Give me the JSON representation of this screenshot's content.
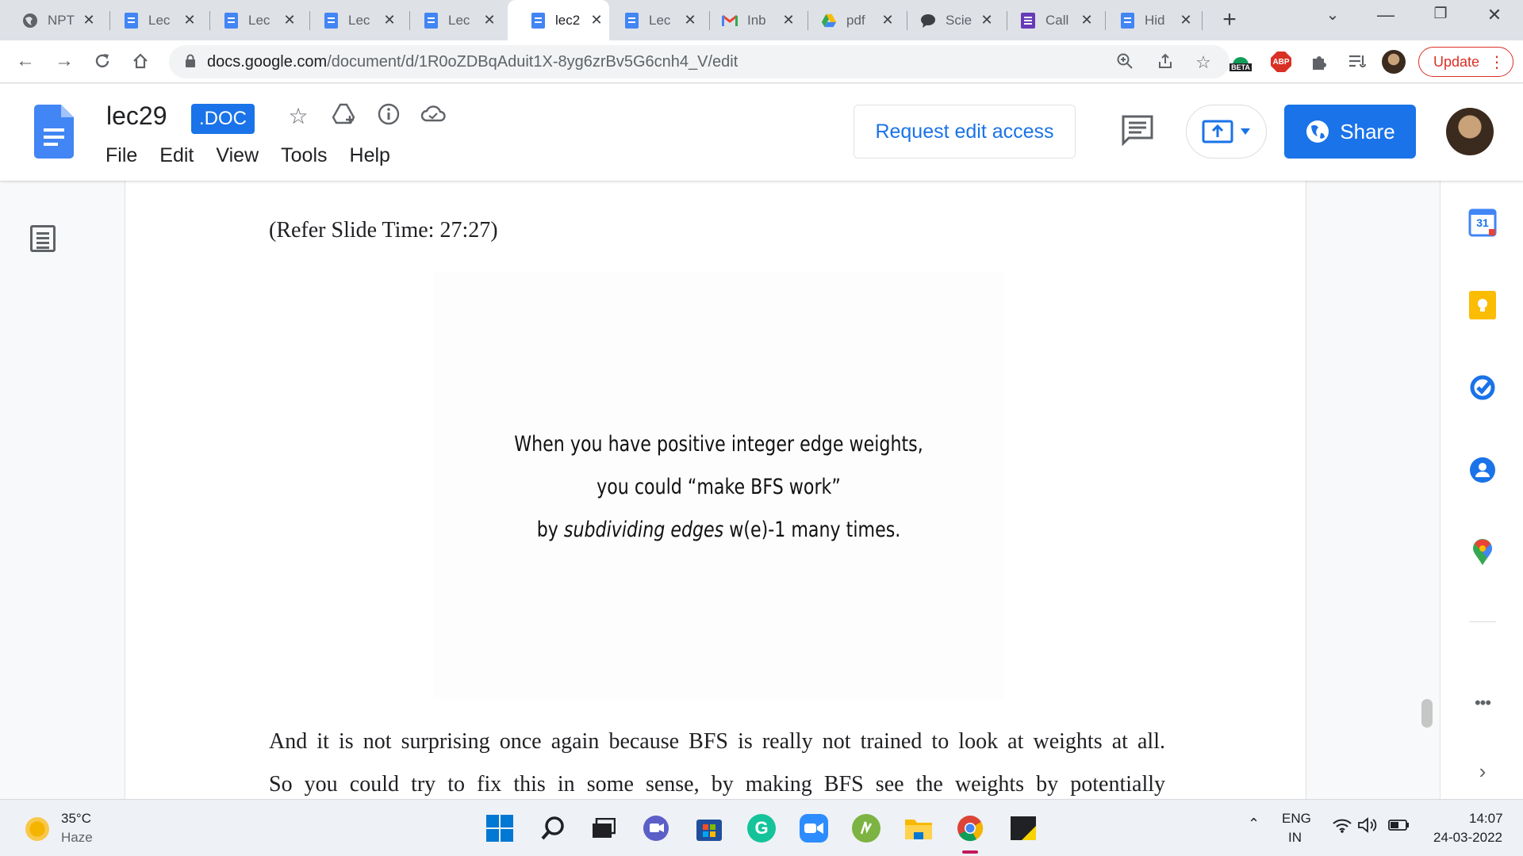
{
  "browser": {
    "tabs": [
      {
        "title": "NPT",
        "icon": "globe-icon"
      },
      {
        "title": "Lec",
        "icon": "docs-icon"
      },
      {
        "title": "Lec",
        "icon": "docs-icon"
      },
      {
        "title": "Lec",
        "icon": "docs-icon"
      },
      {
        "title": "Lec",
        "icon": "docs-icon"
      },
      {
        "title": "lec2",
        "icon": "docs-icon",
        "active": true
      },
      {
        "title": "Lec",
        "icon": "docs-icon"
      },
      {
        "title": "Inb",
        "icon": "gmail-icon"
      },
      {
        "title": "pdf",
        "icon": "drive-icon"
      },
      {
        "title": "Scie",
        "icon": "chat-icon"
      },
      {
        "title": "Call",
        "icon": "forms-icon"
      },
      {
        "title": "Hid",
        "icon": "docs-icon"
      }
    ],
    "new_tab": "+",
    "url_domain": "docs.google.com",
    "url_path": "/document/d/1R0oZDBqAduit1X-8yg6zrBv5G6cnh4_V/edit",
    "beta_label": "BETA",
    "abp_label": "ABP",
    "update_label": "Update"
  },
  "doc": {
    "title": "lec29",
    "badge": ".DOC",
    "menu": [
      "File",
      "Edit",
      "View",
      "Tools",
      "Help"
    ],
    "request_edit": "Request edit access",
    "share": "Share"
  },
  "content": {
    "refer": "(Refer Slide Time: 27:27)",
    "slide": {
      "line1": "When you have positive integer edge weights,",
      "line2": "you could “make BFS work”",
      "line3_pre": "by ",
      "line3_em": "subdividing edges",
      "line3_post": " w(e)-1 many times."
    },
    "para1": "And it is not surprising once again because BFS is really not trained to look at weights at all.",
    "para2": "So you could try to fix this in some sense, by making BFS see the weights by potentially"
  },
  "sidepanel": {
    "calendar_day": "31"
  },
  "taskbar": {
    "temp": "35°C",
    "weather": "Haze",
    "lang1": "ENG",
    "lang2": "IN",
    "time": "14:07",
    "date": "24-03-2022"
  },
  "colors": {
    "accent": "#1a73e8",
    "update": "#d93025",
    "docs_blue": "#4285f4"
  }
}
